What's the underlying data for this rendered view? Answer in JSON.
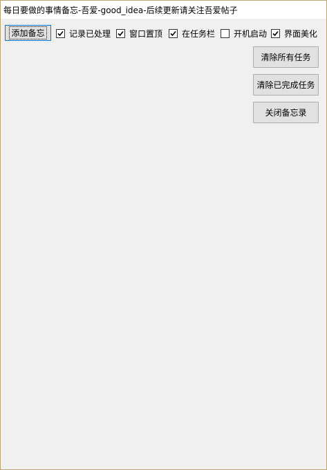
{
  "window": {
    "title": "每日要做的事情备忘-吾爱-good_idea-后续更新请关注吾爱帖子"
  },
  "toolbar": {
    "add_memo_label": "添加备忘",
    "options": [
      {
        "label": "记录已处理",
        "checked": true
      },
      {
        "label": "窗口置顶",
        "checked": true
      },
      {
        "label": "在任务栏",
        "checked": true
      },
      {
        "label": "开机启动",
        "checked": false
      },
      {
        "label": "界面美化",
        "checked": true
      }
    ]
  },
  "side_buttons": {
    "clear_all_label": "清除所有任务",
    "clear_done_label": "清除已完成任务",
    "close_memo_label": "关闭备忘录"
  },
  "colors": {
    "window_bg": "#f0f0f0",
    "titlebar_bg": "#ffffff",
    "button_bg": "#e1e1e1",
    "button_border": "#adadad",
    "focus_border": "#0078d7",
    "frame_border": "#b9a574"
  }
}
